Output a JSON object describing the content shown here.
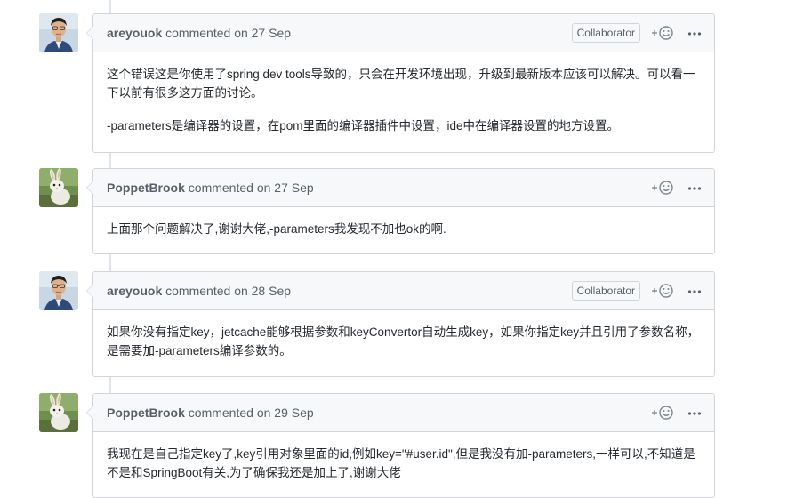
{
  "comments": [
    {
      "author": "areyouok",
      "action": "commented",
      "date": "on 27 Sep",
      "badge": "Collaborator",
      "avatar_icon": "avatar-man-photo",
      "paragraphs": [
        "这个错误这是你使用了spring dev tools导致的，只会在开发环境出现，升级到最新版本应该可以解决。可以看一下以前有很多这方面的讨论。",
        "-parameters是编译器的设置，在pom里面的编译器插件中设置，ide中在编译器设置的地方设置。"
      ]
    },
    {
      "author": "PoppetBrook",
      "action": "commented",
      "date": "on 27 Sep",
      "badge": "",
      "avatar_icon": "avatar-rabbit-photo",
      "paragraphs": [
        "上面那个问题解决了,谢谢大佬,-parameters我发现不加也ok的啊."
      ]
    },
    {
      "author": "areyouok",
      "action": "commented",
      "date": "on 28 Sep",
      "badge": "Collaborator",
      "avatar_icon": "avatar-man-photo",
      "paragraphs": [
        "如果你没有指定key，jetcache能够根据参数和keyConvertor自动生成key，如果你指定key并且引用了参数名称，是需要加-parameters编译参数的。"
      ]
    },
    {
      "author": "PoppetBrook",
      "action": "commented",
      "date": "on 29 Sep",
      "badge": "",
      "avatar_icon": "avatar-rabbit-photo",
      "paragraphs": [
        "我现在是自己指定key了,key引用对象里面的id,例如key=\"#user.id\",但是我没有加-parameters,一样可以,不知道是不是和SpringBoot有关,为了确保我还是加上了,谢谢大佬"
      ]
    }
  ],
  "icons": {
    "reaction": "add-reaction-icon",
    "more": "kebab-menu-icon"
  },
  "colors": {
    "header_bg": "#f6f8fa",
    "border": "#d1d5da",
    "muted_text": "#586069",
    "body_text": "#24292e"
  }
}
